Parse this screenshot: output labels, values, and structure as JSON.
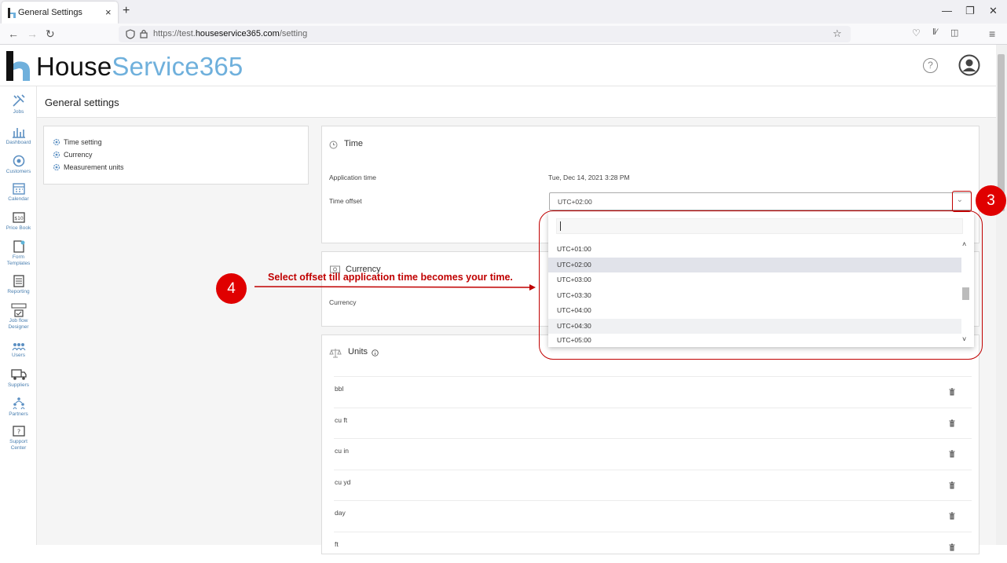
{
  "browser": {
    "tab_title": "General Settings",
    "tab_close": "×",
    "new_tab": "+",
    "url_prefix": "https://test.",
    "url_domain": "houseservice365.com",
    "url_path": "/setting"
  },
  "header": {
    "logo_part1": "House",
    "logo_part2": "Service365",
    "help": "?"
  },
  "sidebar": {
    "items": [
      {
        "label": "Jobs",
        "icon": "tools-icon"
      },
      {
        "label": "Dashboard",
        "icon": "chart-icon"
      },
      {
        "label": "Customers",
        "icon": "customers-icon"
      },
      {
        "label": "Calendar",
        "icon": "calendar-icon"
      },
      {
        "label": "Price Book",
        "icon": "price-icon"
      },
      {
        "label": "Form",
        "label2": "Templates",
        "icon": "form-icon"
      },
      {
        "label": "Reporting",
        "icon": "report-icon"
      },
      {
        "label": "Job flow",
        "label2": "Designer",
        "icon": "flow-icon"
      },
      {
        "label": "Users",
        "icon": "users-icon"
      },
      {
        "label": "Suppliers",
        "icon": "truck-icon"
      },
      {
        "label": "Partners",
        "icon": "partners-icon"
      },
      {
        "label": "Support",
        "label2": "Center",
        "icon": "support-icon"
      }
    ]
  },
  "page": {
    "title": "General settings",
    "menu": [
      "Time setting",
      "Currency",
      "Measurement units"
    ]
  },
  "time": {
    "title": "Time",
    "app_time_label": "Application time",
    "app_time_value": "Tue, Dec 14, 2021 3:28 PM",
    "offset_label": "Time offset",
    "offset_value": "UTC+02:00",
    "options": [
      "UTC+01:00",
      "UTC+02:00",
      "UTC+03:00",
      "UTC+03:30",
      "UTC+04:00",
      "UTC+04:30",
      "UTC+05:00"
    ],
    "selected": "UTC+02:00"
  },
  "currency": {
    "title": "Currency",
    "label": "Currency"
  },
  "units": {
    "title": "Units",
    "items": [
      "bbl",
      "cu ft",
      "cu in",
      "cu yd",
      "day",
      "ft"
    ]
  },
  "annotations": {
    "step3": "3",
    "step4": "4",
    "instruction": "Select offset till application time becomes your time.",
    "color": "#c00000"
  }
}
